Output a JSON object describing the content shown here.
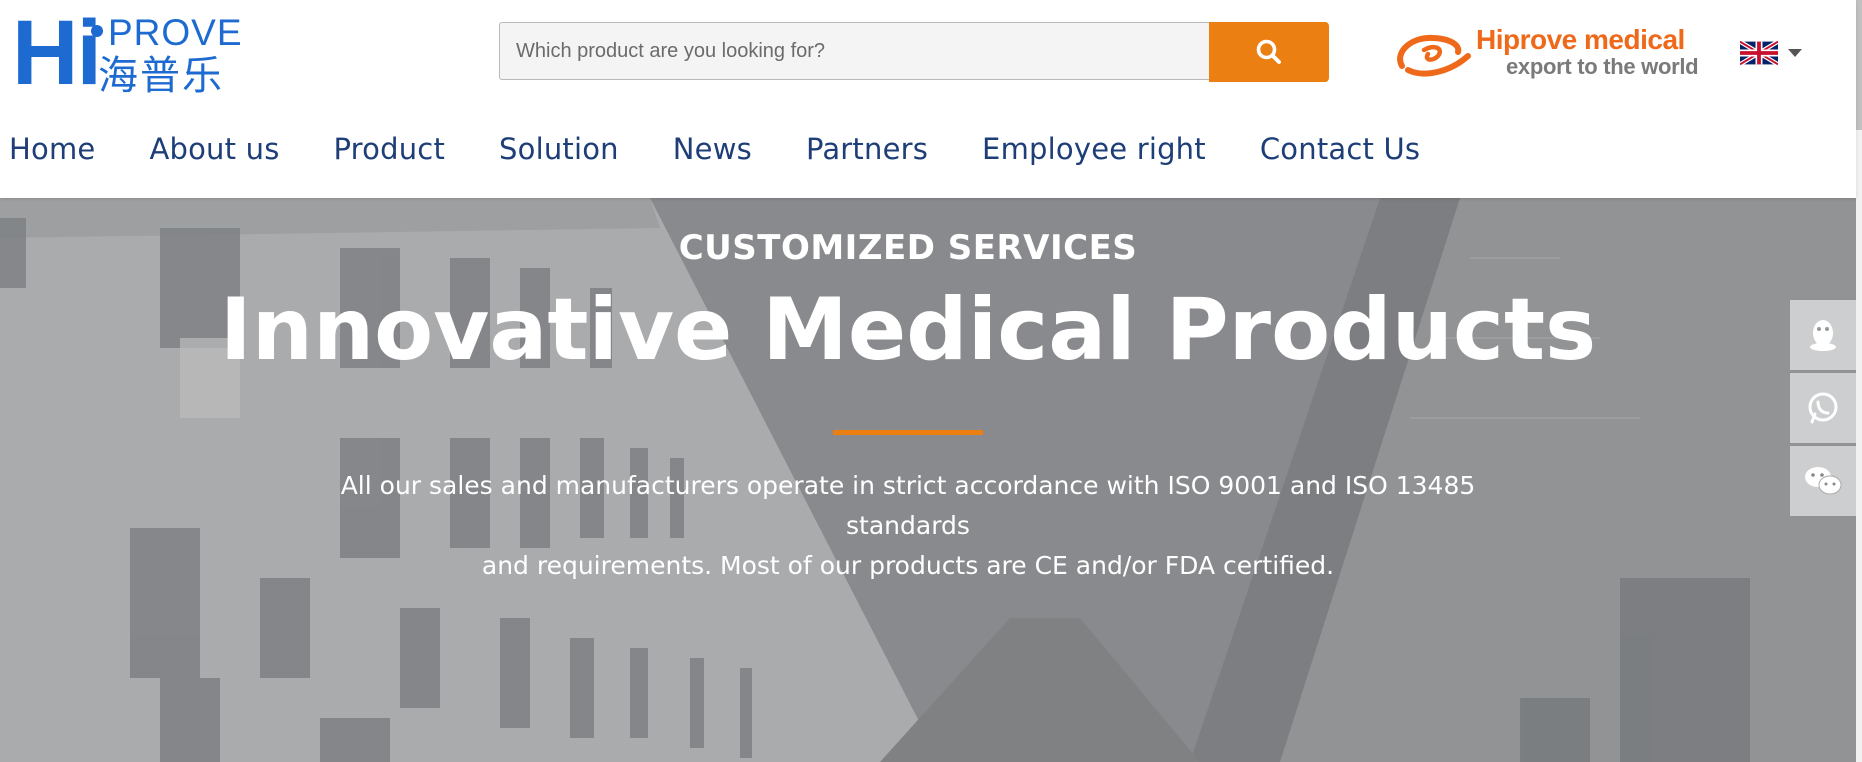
{
  "header": {
    "logo": {
      "hi": "Hi",
      "prove": "PROVE",
      "cn": "海普乐"
    },
    "search": {
      "placeholder": "Which product are you looking for?",
      "button_icon": "search-icon"
    },
    "secondary_brand": {
      "line1": "Hiprove medical",
      "line2": "export to the world",
      "icon": "alibaba-logo-icon"
    },
    "language": {
      "flag_icon": "uk-flag-icon",
      "dropdown_icon": "caret-down-icon"
    }
  },
  "nav": {
    "items": [
      "Home",
      "About us",
      "Product",
      "Solution",
      "News",
      "Partners",
      "Employee right",
      "Contact Us"
    ]
  },
  "hero": {
    "subtitle": "CUSTOMIZED SERVICES",
    "title": "Innovative Medical Products",
    "description_line1": "All our sales and manufacturers operate in strict accordance with ISO 9001 and ISO 13485 standards",
    "description_line2": "and requirements. Most of our products are CE and/or FDA certified.",
    "accent_color": "#ec7f12"
  },
  "side_tools": [
    {
      "icon": "qq-penguin-icon"
    },
    {
      "icon": "whatsapp-icon"
    },
    {
      "icon": "wechat-icon"
    }
  ],
  "colors": {
    "brand_blue": "#1d6ad1",
    "nav_text": "#1e3e78",
    "accent_orange": "#ec7f12"
  }
}
